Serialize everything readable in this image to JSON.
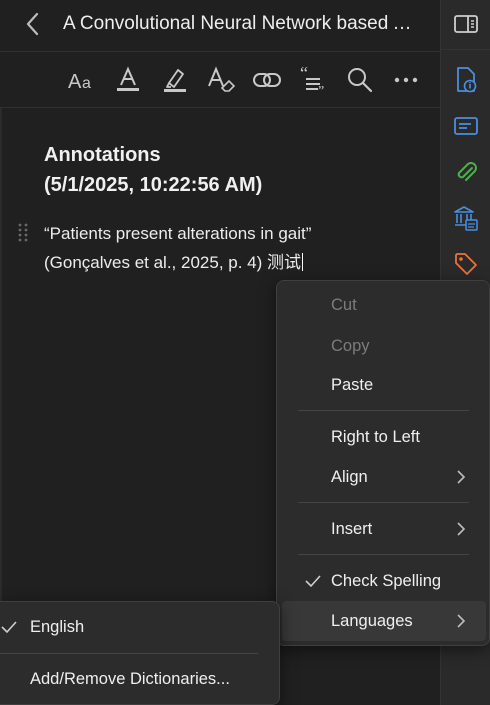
{
  "header": {
    "title": "A Convolutional Neural Network based Approach for Assessing Gait"
  },
  "toolbar": {
    "icons": [
      "text-style-icon",
      "font-color-icon",
      "highlighter-icon",
      "clear-format-icon",
      "link-icon",
      "quote-icon",
      "search-icon",
      "more-icon"
    ]
  },
  "note": {
    "heading_line1": "Annotations",
    "heading_line2": "(5/1/2025, 10:22:56 AM)",
    "quote_line1": "“Patients present alterations in gait”",
    "quote_line2": "(Gonçalves et al., 2025, p. 4) 测试"
  },
  "sidebar": {
    "icons": [
      "toggle-sidebar-icon",
      "info-document-icon",
      "abstract-icon",
      "attachment-icon",
      "library-icon",
      "tag-icon"
    ],
    "colors": {
      "info": "#4a8fe0",
      "abstract": "#4a8fe0",
      "attachment": "#4caf50",
      "library": "#4a8fe0",
      "tag": "#e8743b"
    }
  },
  "context_menu": {
    "cut": "Cut",
    "copy": "Copy",
    "paste": "Paste",
    "right_to_left": "Right to Left",
    "align": "Align",
    "insert": "Insert",
    "check_spelling": "Check Spelling",
    "languages": "Languages"
  },
  "languages_menu": {
    "english": "English",
    "dictionaries": "Add/Remove Dictionaries..."
  }
}
